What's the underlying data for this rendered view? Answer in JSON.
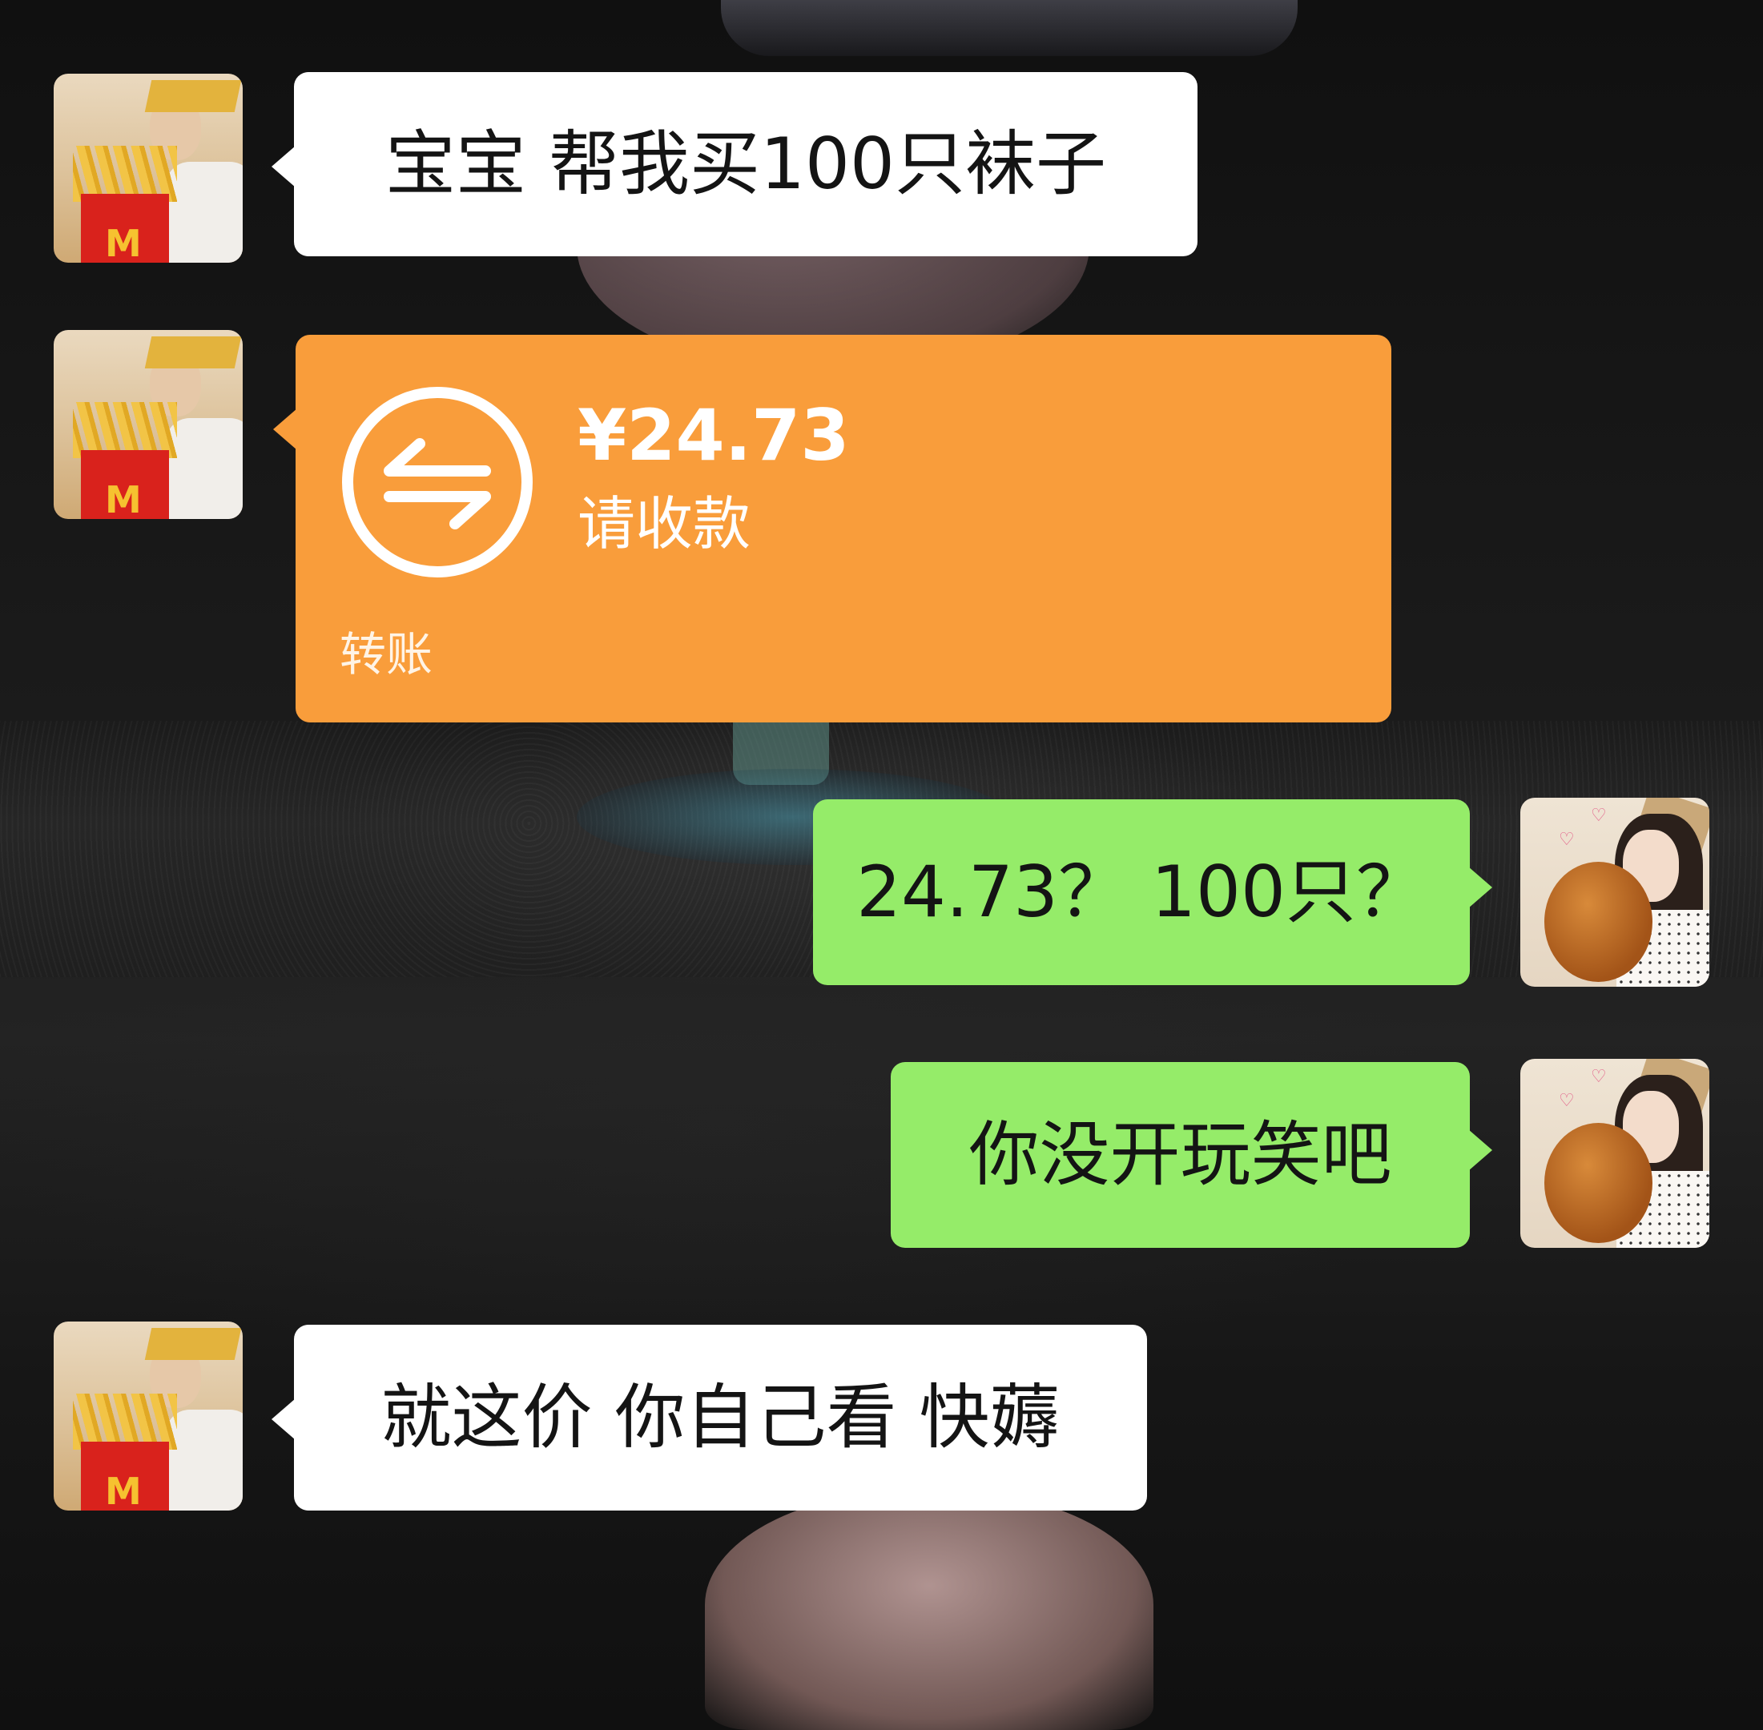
{
  "messages": [
    {
      "sender": "contact",
      "type": "text",
      "text": "宝宝 帮我买100只袜子"
    },
    {
      "sender": "contact",
      "type": "transfer",
      "amount": "¥24.73",
      "status": "请收款",
      "footer": "转账"
    },
    {
      "sender": "self",
      "type": "text",
      "text": "24.73？ 100只？"
    },
    {
      "sender": "self",
      "type": "text",
      "text": "你没开玩笑吧"
    },
    {
      "sender": "contact",
      "type": "text",
      "text": "就这价 你自己看 快薅"
    }
  ],
  "colors": {
    "incoming_bubble": "#ffffff",
    "outgoing_bubble": "#95ec69",
    "transfer_card": "#f99d3b",
    "text": "#141414"
  },
  "icons": {
    "transfer": "transfer-arrows-icon"
  }
}
